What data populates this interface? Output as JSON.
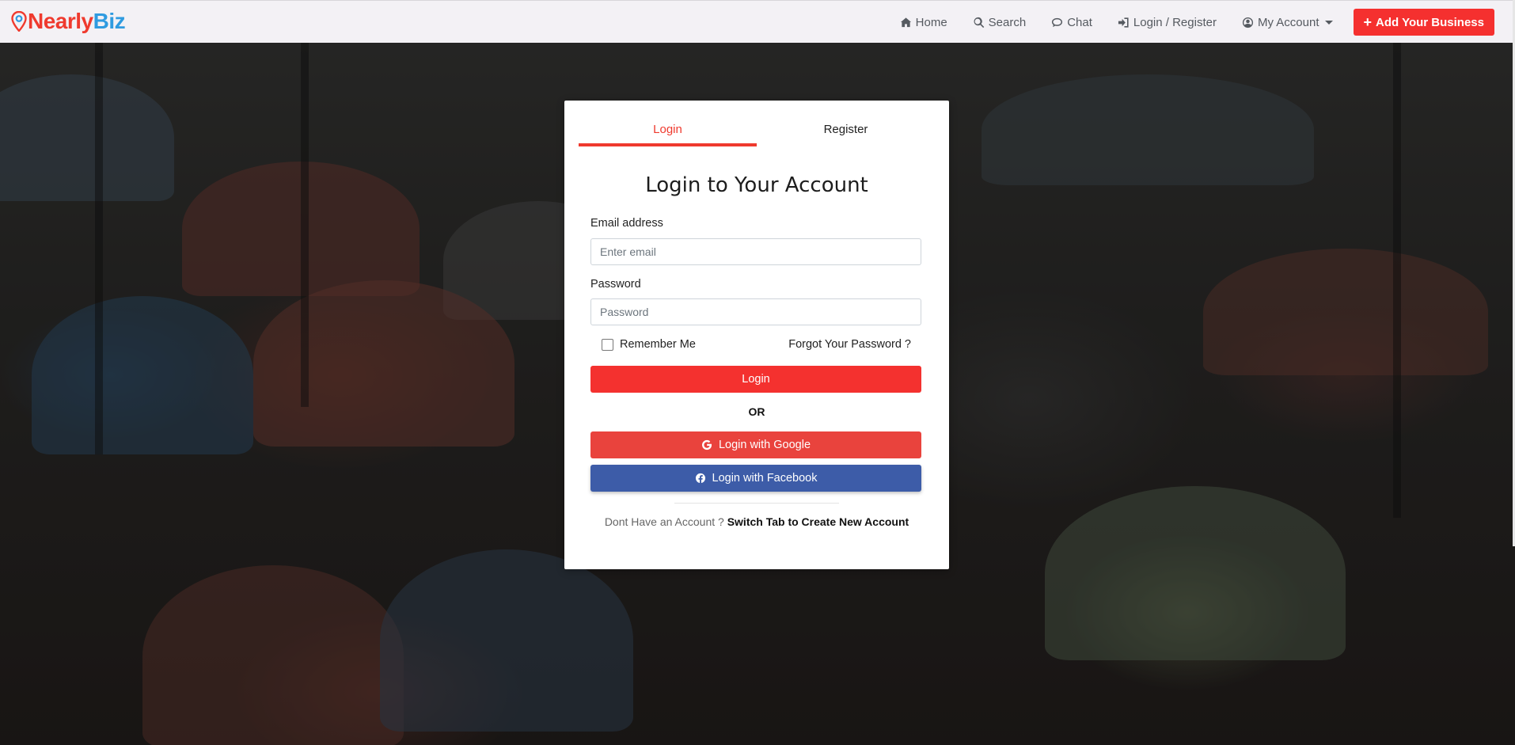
{
  "brand": {
    "part1": "Nearly",
    "part2": "Biz"
  },
  "nav": {
    "home": "Home",
    "search": "Search",
    "chat": "Chat",
    "login_register": "Login / Register",
    "my_account": "My Account",
    "add_business": "Add Your Business"
  },
  "tabs": {
    "login": "Login",
    "register": "Register",
    "active": "Login"
  },
  "form": {
    "title": "Login to Your Account",
    "email_label": "Email address",
    "email_placeholder": "Enter email",
    "email_value": "",
    "password_label": "Password",
    "password_placeholder": "Password",
    "password_value": "",
    "remember_label": "Remember Me",
    "remember_checked": false,
    "forgot_label": "Forgot Your Password ?",
    "login_button": "Login",
    "or_text": "OR",
    "google_button": "Login with Google",
    "facebook_button": "Login with Facebook",
    "no_account_text": "Dont Have an Account ?",
    "switch_tab_link": "Switch Tab to Create New Account"
  },
  "colors": {
    "accent": "#ef3a2e",
    "brand_blue": "#2f9be0",
    "google": "#e9433d",
    "facebook": "#3d5ca8"
  },
  "icons": {
    "home": "home-icon",
    "search": "search-icon",
    "chat": "chat-icon",
    "login": "sign-in-icon",
    "account": "user-circle-icon",
    "add": "plus-icon",
    "google": "google-icon",
    "facebook": "facebook-icon",
    "logo": "map-pin-icon"
  }
}
